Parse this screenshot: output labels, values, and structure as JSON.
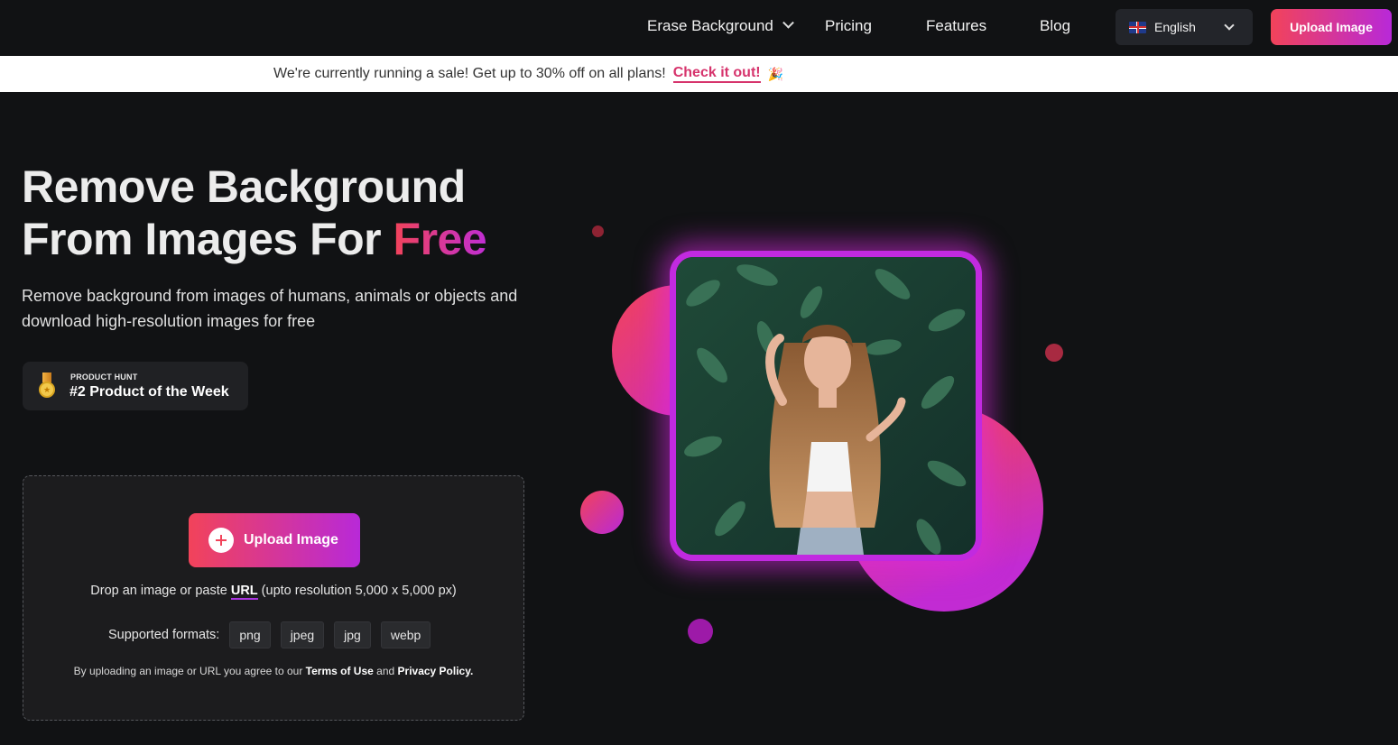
{
  "nav": {
    "items": [
      {
        "label": "Erase Background",
        "dropdown": true
      },
      {
        "label": "Pricing"
      },
      {
        "label": "Features"
      },
      {
        "label": "Blog"
      }
    ],
    "language": "English",
    "upload_label": "Upload Image"
  },
  "banner": {
    "text": "We're currently running a sale! Get up to 30% off on all plans!",
    "link": "Check it out!",
    "emoji": "🎉"
  },
  "hero": {
    "title_line1": "Remove Background",
    "title_line2_prefix": "From Images For ",
    "title_highlight": "Free",
    "subtitle": "Remove background from images of humans, animals or objects and download high-resolution images for free"
  },
  "badge": {
    "small": "PRODUCT HUNT",
    "big": "#2 Product of the Week"
  },
  "upload": {
    "button_label": "Upload Image",
    "drop_prefix": "Drop an image or paste ",
    "drop_url": "URL",
    "drop_suffix": " (upto resolution 5,000 x 5,000 px)",
    "formats_label": "Supported formats:",
    "formats": [
      "png",
      "jpeg",
      "jpg",
      "webp"
    ],
    "terms_prefix": "By uploading an image or URL you agree to our ",
    "terms_link": "Terms of Use",
    "terms_and": " and ",
    "privacy_link": "Privacy Policy."
  },
  "colors": {
    "accent_start": "#f2435a",
    "accent_end": "#b829d8",
    "background": "#111214"
  }
}
